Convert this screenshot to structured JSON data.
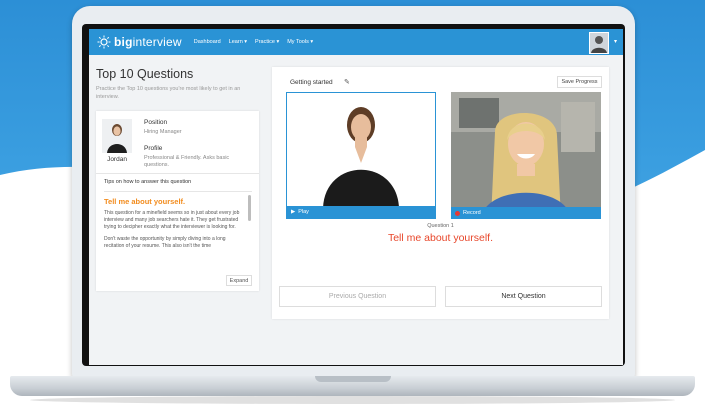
{
  "navbar": {
    "logo_bold": "big",
    "logo_light": "interview",
    "items": [
      "Dashboard",
      "Learn ▾",
      "Practice ▾",
      "My Tools ▾"
    ],
    "caret": "▾"
  },
  "page": {
    "title": "Top 10 Questions",
    "subtitle": "Practice the Top 10 questions you're most likely to get in an interview."
  },
  "profile": {
    "name": "Jordan",
    "position_label": "Position",
    "position_value": "Hiring Manager",
    "profile_label": "Profile",
    "profile_value": "Professional & Friendly. Asks basic questions."
  },
  "tips": {
    "title": "Tips on how to answer this question",
    "question": "Tell me about yourself.",
    "paragraphs": [
      "This question for a minefield seems so in just about every job interview and many job searchers hate it. They get frustrated trying to decipher exactly what the interviewer is looking for.",
      "Don't waste the opportunity by simply diving into a long recitation of your resume. This also isn't the time"
    ],
    "expand_label": "Expand"
  },
  "practice": {
    "getting_started": "Getting started",
    "save_progress": "Save Progress",
    "play_label": "Play",
    "record_label": "Record",
    "question_number": "Question 1",
    "question_text": "Tell me about yourself.",
    "prev_label": "Previous Question",
    "next_label": "Next Question"
  },
  "colors": {
    "brand_blue": "#2a93d5",
    "question_red": "#e8472b",
    "tips_orange": "#f28c1e"
  },
  "icons": [
    "sun-logo-icon",
    "pencil-icon",
    "play-icon",
    "record-dot-icon",
    "avatar-icon"
  ]
}
